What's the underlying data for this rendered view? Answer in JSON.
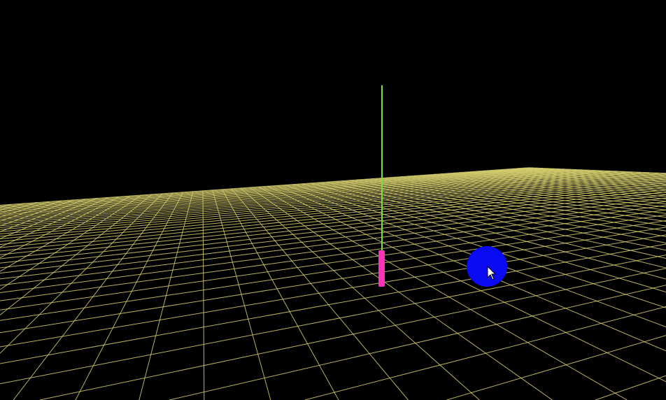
{
  "scene": {
    "background_color": "#000000",
    "grid_color": "#d8d070",
    "axis_line_color": "#7de03a",
    "cylinder_color": "#ff33bb",
    "sphere_color": "#0a0af5",
    "cursor_icon": "arrow-cursor-icon"
  }
}
